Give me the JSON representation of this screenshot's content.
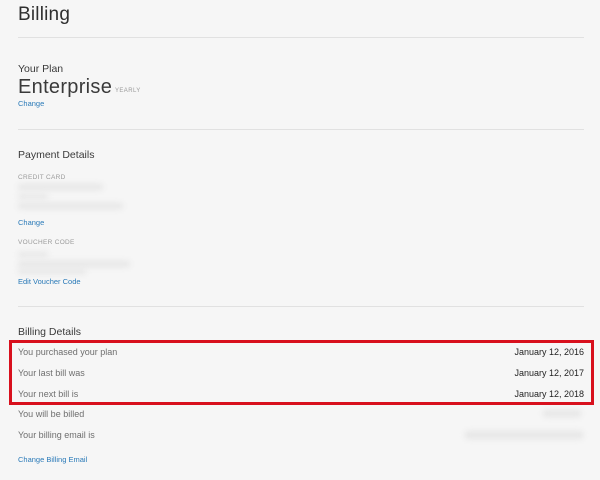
{
  "page": {
    "title": "Billing"
  },
  "plan": {
    "heading": "Your Plan",
    "name": "Enterprise",
    "period": "YEARLY",
    "change_label": "Change"
  },
  "payment": {
    "heading": "Payment Details",
    "credit_card_label": "CREDIT CARD",
    "change_label": "Change",
    "voucher_label": "VOUCHER CODE",
    "edit_voucher_label": "Edit Voucher Code"
  },
  "billing": {
    "heading": "Billing Details",
    "rows": [
      {
        "label": "You purchased your plan",
        "value": "January 12, 2016"
      },
      {
        "label": "Your last bill was",
        "value": "January 12, 2017"
      },
      {
        "label": "Your next bill is",
        "value": "January 12, 2018"
      },
      {
        "label": "You will be billed",
        "value": ""
      },
      {
        "label": "Your billing email is",
        "value": ""
      }
    ],
    "change_email_label": "Change Billing Email"
  },
  "colors": {
    "background": "#f6f6f6",
    "link": "#2a7ab8",
    "highlight": "#d8101d"
  }
}
